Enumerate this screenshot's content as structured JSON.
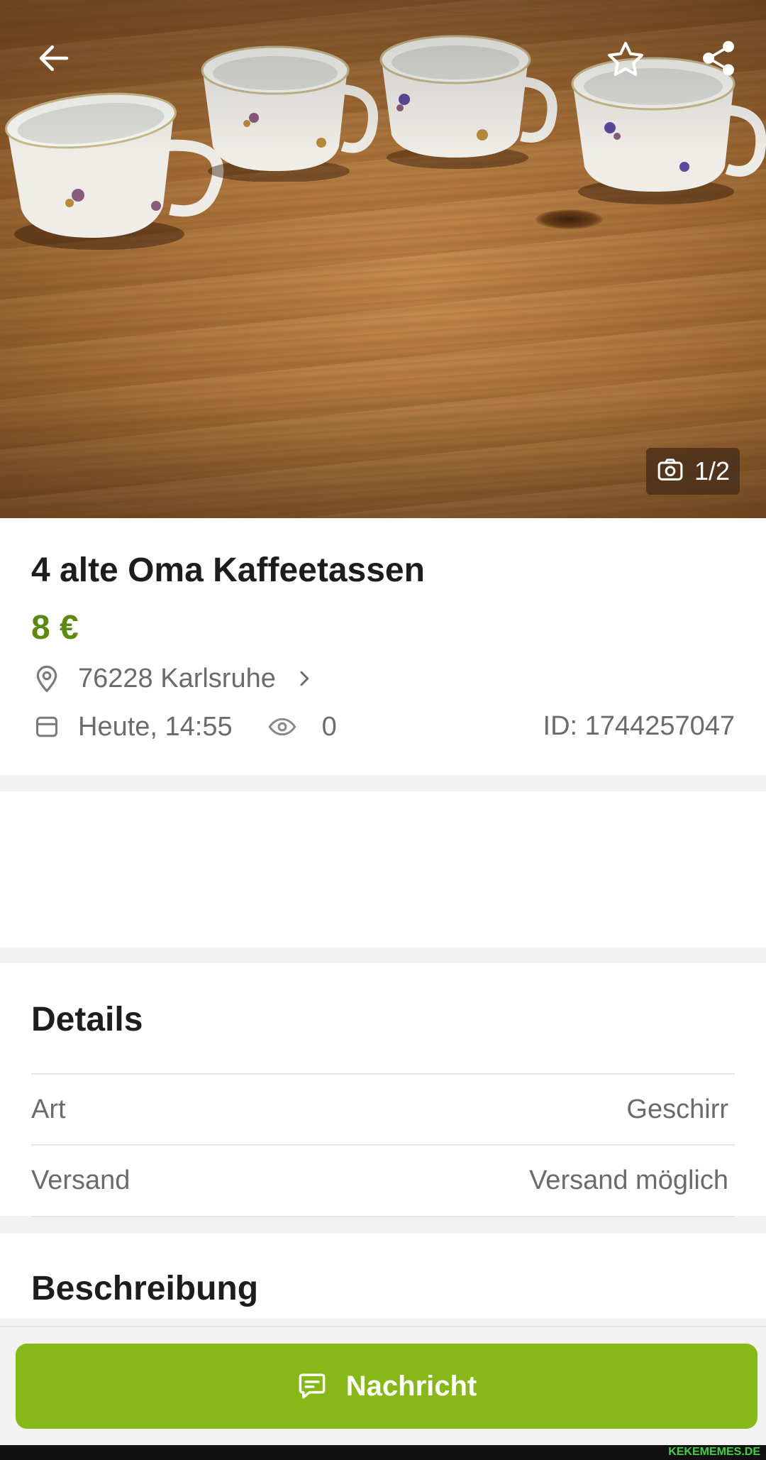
{
  "hero": {
    "image_counter": "1/2",
    "icons": {
      "back": "arrow-left-icon",
      "favorite": "star-outline-icon",
      "share": "share-icon",
      "camera": "camera-icon"
    }
  },
  "listing": {
    "title": "4 alte Oma Kaffeetassen",
    "price": "8 €",
    "location": "76228 Karlsruhe",
    "date": "Heute, 14:55",
    "views": "0",
    "id_text": "ID: 1744257047"
  },
  "details": {
    "heading": "Details",
    "rows": [
      {
        "label": "Art",
        "value": "Geschirr"
      },
      {
        "label": "Versand",
        "value": "Versand möglich"
      }
    ]
  },
  "description": {
    "heading": "Beschreibung"
  },
  "action": {
    "message_label": "Nachricht"
  },
  "footer": {
    "watermark": "KEKEMEMES.DE"
  },
  "colors": {
    "accent": "#86b817",
    "price": "#5c8a0f",
    "muted_text": "#6b6b6b"
  }
}
